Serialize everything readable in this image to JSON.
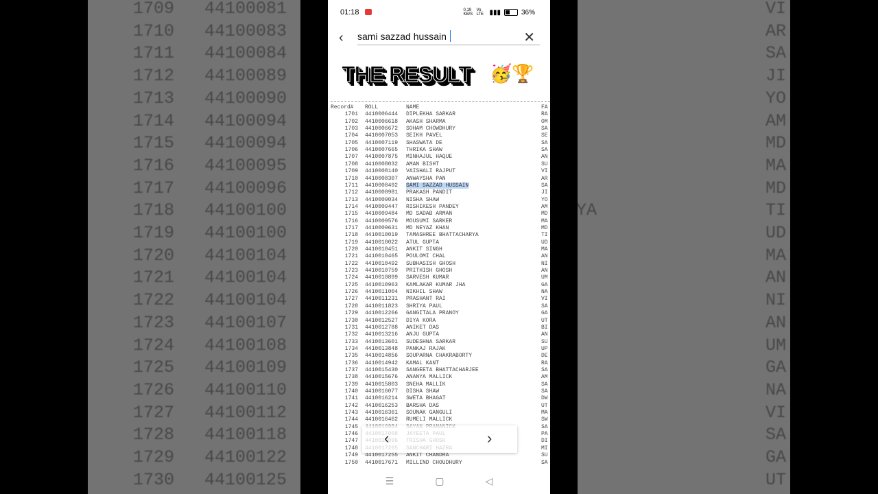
{
  "status_bar": {
    "time": "01:18",
    "speed": "0.19 KB/S",
    "network": "Vo LTE",
    "battery": "36%"
  },
  "search": {
    "query": "sami sazzad hussain"
  },
  "banner": {
    "text": "THE RESULT",
    "emoji": "🥳🏆"
  },
  "table": {
    "headers": [
      "Record#",
      "ROLL",
      "NAME",
      "FA"
    ],
    "highlight_record": "1711",
    "rows": [
      [
        "1701",
        "4410006444",
        "DIPLEKHA SARKAR",
        "RA"
      ],
      [
        "1702",
        "4410006618",
        "AKASH SHARMA",
        "OM"
      ],
      [
        "1703",
        "4410006672",
        "SOHAM CHOWDHURY",
        "SA"
      ],
      [
        "1704",
        "4410007053",
        "SEIKH PAVEL",
        "SE"
      ],
      [
        "1705",
        "4410007119",
        "SHASWATA DE",
        "SA"
      ],
      [
        "1706",
        "4410007665",
        "THRIKA SHAW",
        "SA"
      ],
      [
        "1707",
        "4410007875",
        "MINHAJUL HAQUE",
        "AN"
      ],
      [
        "1708",
        "4410008032",
        "AMAN BISHT",
        "SU"
      ],
      [
        "1709",
        "4410008140",
        "VAISHALI RAJPUT",
        "VI"
      ],
      [
        "1710",
        "4410008307",
        "ANWAYSHA PAN",
        "AR"
      ],
      [
        "1711",
        "4410008492",
        "SAMI SAZZAD HUSSAIN",
        "SA"
      ],
      [
        "1712",
        "4410008981",
        "PRAKASH PANDIT",
        "JI"
      ],
      [
        "1713",
        "4410009034",
        "NISHA SHAW",
        "YO"
      ],
      [
        "1714",
        "4410009447",
        "RISHIKESH PANDEY",
        "AM"
      ],
      [
        "1715",
        "4410009484",
        "MD SADAB ARMAN",
        "MD"
      ],
      [
        "1716",
        "4410009576",
        "MOUSUMI SARKER",
        "MA"
      ],
      [
        "1717",
        "4410009631",
        "MD NEYAZ KHAN",
        "MD"
      ],
      [
        "1718",
        "4410010019",
        "TAMASHREE BHATTACHARYA",
        "TI"
      ],
      [
        "1719",
        "4410010022",
        "ATUL GUPTA",
        "UD"
      ],
      [
        "1720",
        "4410010451",
        "ANKIT SINGH",
        "MA"
      ],
      [
        "1721",
        "4410010465",
        "POULOMI CHAL",
        "AN"
      ],
      [
        "1722",
        "4410010492",
        "SUBHASISH GHOSH",
        "NI"
      ],
      [
        "1723",
        "4410010759",
        "PRITHISH GHOSH",
        "AN"
      ],
      [
        "1724",
        "4410010899",
        "SARVESH KUMAR",
        "UM"
      ],
      [
        "1725",
        "4410010963",
        "KAMLAKAR KUMAR JHA",
        "GA"
      ],
      [
        "1726",
        "4410011004",
        "NIKHIL SHAW",
        "NA"
      ],
      [
        "1727",
        "4410011231",
        "PRASHANT RAI",
        "VI"
      ],
      [
        "1728",
        "4410011823",
        "SHRIYA PAUL",
        "SA"
      ],
      [
        "1729",
        "4410012266",
        "GANGITALA PRANOY",
        "GA"
      ],
      [
        "1730",
        "4410012527",
        "DIYA KORA",
        "UT"
      ],
      [
        "1731",
        "4410012788",
        "ANIKET DAS",
        "BI"
      ],
      [
        "1732",
        "4410013216",
        "ANJU GUPTA",
        "AN"
      ],
      [
        "1733",
        "4410013601",
        "SUDESHNA SARKAR",
        "SU"
      ],
      [
        "1734",
        "4410013848",
        "PANKAJ RAJAK",
        "UP"
      ],
      [
        "1735",
        "4410014856",
        "SOUPARNA CHAKRABORTY",
        "DE"
      ],
      [
        "1736",
        "4410014942",
        "KAMAL KANT",
        "RA"
      ],
      [
        "1737",
        "4410015430",
        "SANGEETA BHATTACHARJEE",
        "SA"
      ],
      [
        "1738",
        "4410015676",
        "ANANYA MALLICK",
        "AM"
      ],
      [
        "1739",
        "4410015803",
        "SNEHA MALLIK",
        "SA"
      ],
      [
        "1740",
        "4410016077",
        "DISHA SHAW",
        "SA"
      ],
      [
        "1741",
        "4410016214",
        "SWETA BHAGAT",
        "DW"
      ],
      [
        "1742",
        "4410016253",
        "BARSHA DAS",
        "UT"
      ],
      [
        "1743",
        "4410016361",
        "SOUNAK GANGULI",
        "MA"
      ],
      [
        "1744",
        "4410016462",
        "RUMELI MALLICK",
        "SW"
      ],
      [
        "1745",
        "4410016984",
        "SAYAN PRAMANICK",
        "SA"
      ],
      [
        "1746",
        "4410017008",
        "JAYEETA PAUL",
        "PA"
      ],
      [
        "1747",
        "4410017096",
        "TRISHA GHOSH",
        "DI"
      ],
      [
        "1748",
        "4410017205",
        "SANCHARI HAZRA",
        "MI"
      ],
      [
        "1749",
        "4410017255",
        "ANKIT CHANDRA",
        "SU"
      ],
      [
        "1750",
        "4410017671",
        "MILLIND CHOUDHURY",
        "SA"
      ]
    ]
  },
  "bg_left": [
    [
      "1709",
      "44100081"
    ],
    [
      "1710",
      "44100083"
    ],
    [
      "1711",
      "44100084"
    ],
    [
      "1712",
      "44100089"
    ],
    [
      "1713",
      "44100090"
    ],
    [
      "1714",
      "44100094"
    ],
    [
      "1715",
      "44100094"
    ],
    [
      "1716",
      "44100095"
    ],
    [
      "1717",
      "44100096"
    ],
    [
      "1718",
      "44100100"
    ],
    [
      "1719",
      "44100100"
    ],
    [
      "1720",
      "44100104"
    ],
    [
      "1721",
      "44100104"
    ],
    [
      "1722",
      "44100104"
    ],
    [
      "1723",
      "44100107"
    ],
    [
      "1724",
      "44100108"
    ],
    [
      "1725",
      "44100109"
    ],
    [
      "1726",
      "44100110"
    ],
    [
      "1727",
      "44100112"
    ],
    [
      "1728",
      "44100118"
    ],
    [
      "1729",
      "44100122"
    ],
    [
      "1730",
      "44100125"
    ]
  ],
  "bg_right": [
    "VI",
    "AR",
    "SA",
    "JI",
    "YO",
    "AM",
    "MD",
    "MA",
    "MD",
    "TI",
    "UD",
    "MA",
    "AN",
    "NI",
    "AN",
    "UM",
    "GA",
    "NA",
    "VI",
    "SA",
    "GA",
    "UT"
  ],
  "bg_right_extra": "YA"
}
